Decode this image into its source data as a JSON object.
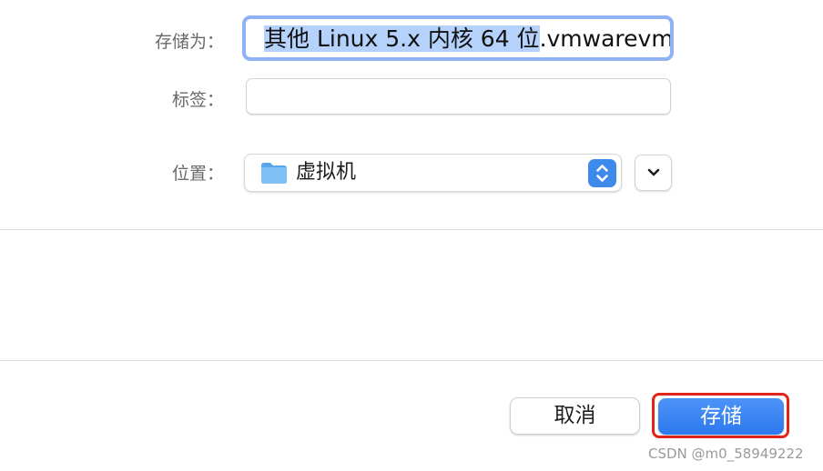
{
  "dialog": {
    "save_as": {
      "label": "存储为：",
      "selected_text": "其他 Linux 5.x 内核 64 位",
      "rest_text": ".vmwarevm"
    },
    "tags": {
      "label": "标签：",
      "value": "",
      "placeholder": ""
    },
    "where": {
      "label": "位置：",
      "value": "虚拟机",
      "folder_icon": "folder-icon",
      "stepper_icon": "up-down-chevron-icon"
    },
    "expand_icon": "chevron-down-icon",
    "buttons": {
      "cancel": "取消",
      "save": "存储"
    }
  },
  "watermark": "CSDN @m0_58949222",
  "colors": {
    "focus_ring": "#8fb2f5",
    "selection": "#b4d2fb",
    "accent": "#2c78f0",
    "annotation": "#e1251b"
  }
}
